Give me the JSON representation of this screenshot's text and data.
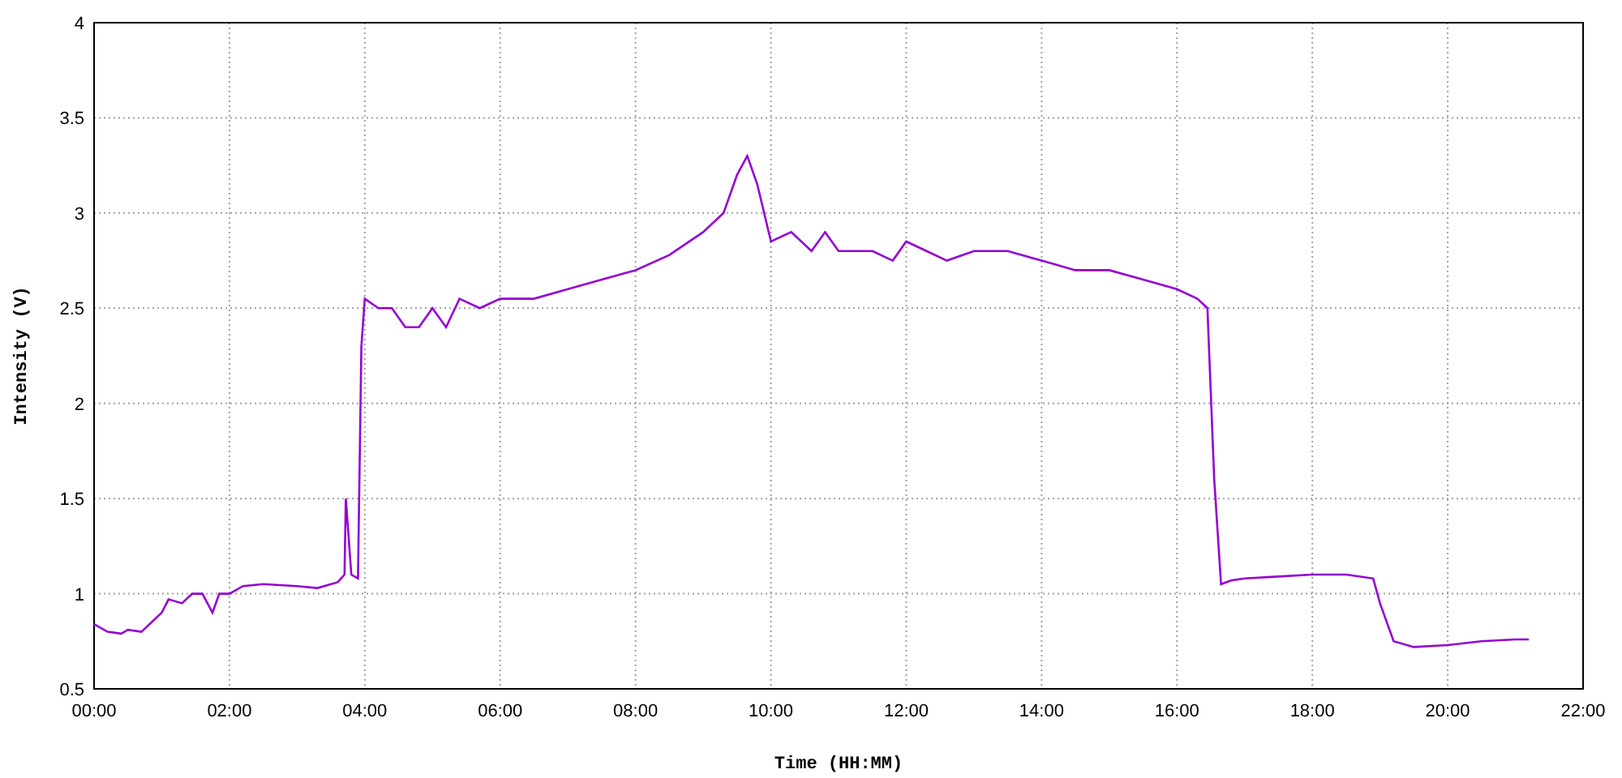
{
  "chart": {
    "chart_data": {
      "type": "line",
      "xlabel": "Time (HH:MM)",
      "ylabel": "Intensity (V)",
      "xlim": [
        0,
        22
      ],
      "ylim": [
        0.5,
        4
      ],
      "xticks": [
        {
          "value": 0,
          "label": "00:00"
        },
        {
          "value": 2,
          "label": "02:00"
        },
        {
          "value": 4,
          "label": "04:00"
        },
        {
          "value": 6,
          "label": "06:00"
        },
        {
          "value": 8,
          "label": "08:00"
        },
        {
          "value": 10,
          "label": "10:00"
        },
        {
          "value": 12,
          "label": "12:00"
        },
        {
          "value": 14,
          "label": "14:00"
        },
        {
          "value": 16,
          "label": "16:00"
        },
        {
          "value": 18,
          "label": "18:00"
        },
        {
          "value": 20,
          "label": "20:00"
        },
        {
          "value": 22,
          "label": "22:00"
        }
      ],
      "yticks": [
        {
          "value": 0.5,
          "label": "0.5"
        },
        {
          "value": 1,
          "label": "1"
        },
        {
          "value": 1.5,
          "label": "1.5"
        },
        {
          "value": 2,
          "label": "2"
        },
        {
          "value": 2.5,
          "label": "2.5"
        },
        {
          "value": 3,
          "label": "3"
        },
        {
          "value": 3.5,
          "label": "3.5"
        },
        {
          "value": 4,
          "label": "4"
        }
      ],
      "x": [
        0,
        0.2,
        0.4,
        0.5,
        0.7,
        1.0,
        1.1,
        1.3,
        1.45,
        1.6,
        1.75,
        1.85,
        2.0,
        2.2,
        2.5,
        3.0,
        3.3,
        3.6,
        3.7,
        3.72,
        3.8,
        3.9,
        3.95,
        4.0,
        4.2,
        4.4,
        4.6,
        4.8,
        5.0,
        5.2,
        5.4,
        5.7,
        6.0,
        6.5,
        7.0,
        7.5,
        8.0,
        8.5,
        9.0,
        9.3,
        9.5,
        9.65,
        9.8,
        10.0,
        10.3,
        10.6,
        10.8,
        11.0,
        11.5,
        11.8,
        12.0,
        12.3,
        12.6,
        13.0,
        13.5,
        14.0,
        14.5,
        15.0,
        15.5,
        16.0,
        16.3,
        16.45,
        16.55,
        16.65,
        16.8,
        17.0,
        17.5,
        18.0,
        18.5,
        18.9,
        19.0,
        19.2,
        19.5,
        20.0,
        20.5,
        21.0,
        21.2
      ],
      "grid": true,
      "series": [
        {
          "color": "#9400d3",
          "values": [
            0.84,
            0.8,
            0.79,
            0.81,
            0.8,
            0.9,
            0.97,
            0.95,
            1.0,
            1.0,
            0.9,
            1.0,
            1.0,
            1.04,
            1.05,
            1.04,
            1.03,
            1.06,
            1.1,
            1.5,
            1.1,
            1.08,
            2.3,
            2.55,
            2.5,
            2.5,
            2.4,
            2.4,
            2.5,
            2.4,
            2.55,
            2.5,
            2.55,
            2.55,
            2.6,
            2.65,
            2.7,
            2.78,
            2.9,
            3.0,
            3.2,
            3.3,
            3.15,
            2.85,
            2.9,
            2.8,
            2.9,
            2.8,
            2.8,
            2.75,
            2.85,
            2.8,
            2.75,
            2.8,
            2.8,
            2.75,
            2.7,
            2.7,
            2.65,
            2.6,
            2.55,
            2.5,
            1.6,
            1.05,
            1.07,
            1.08,
            1.09,
            1.1,
            1.1,
            1.08,
            0.95,
            0.75,
            0.72,
            0.73,
            0.75,
            0.76,
            0.76
          ]
        }
      ]
    }
  }
}
